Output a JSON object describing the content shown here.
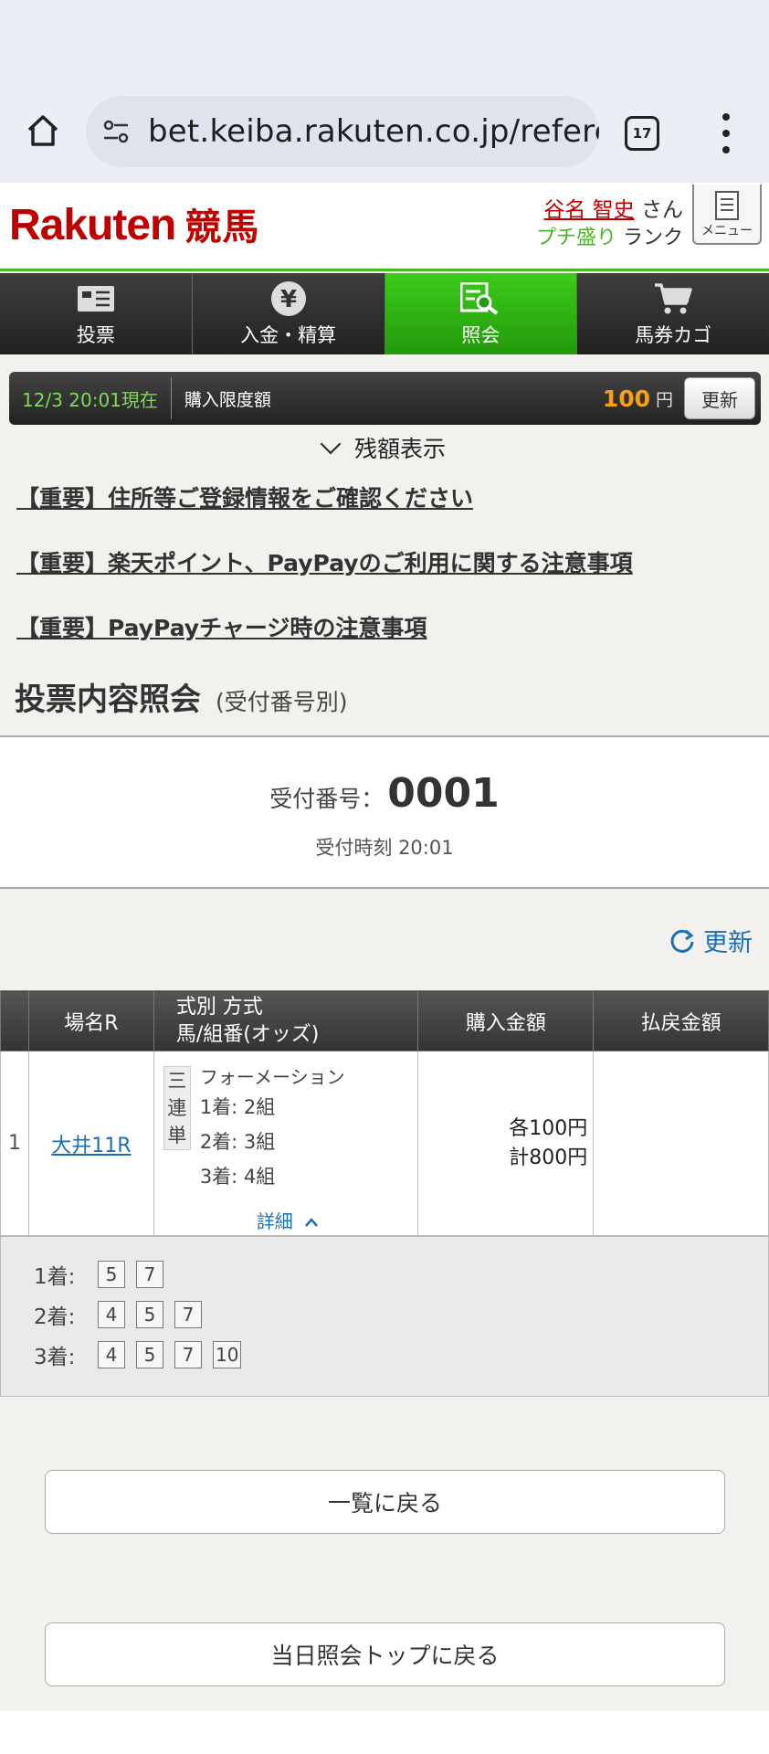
{
  "browser": {
    "url": "bet.keiba.rakuten.co.jp/referen",
    "tab_count": "17"
  },
  "header": {
    "logo_brand": "Rakuten",
    "logo_suffix": "競馬",
    "user_name": "谷名 智史",
    "user_honorific": "さん",
    "rank_name": "プチ盛り",
    "rank_label": "ランク",
    "menu_label": "メニュー"
  },
  "nav": [
    {
      "label": "投票",
      "icon": "ballot-icon",
      "active": false
    },
    {
      "label": "入金・精算",
      "icon": "yen-icon",
      "active": false
    },
    {
      "label": "照会",
      "icon": "inquiry-icon",
      "active": true
    },
    {
      "label": "馬券カゴ",
      "icon": "cart-icon",
      "active": false
    }
  ],
  "info_bar": {
    "datetime": "12/3 20:01現在",
    "limit_label": "購入限度額",
    "limit_amount": "100",
    "limit_unit": "円",
    "refresh_label": "更新"
  },
  "balance_toggle": "残額表示",
  "notices": [
    "【重要】住所等ご登録情報をご確認ください",
    "【重要】楽天ポイント、PayPayのご利用に関する注意事項",
    "【重要】PayPayチャージ時の注意事項"
  ],
  "section": {
    "title": "投票内容照会",
    "subtitle": "(受付番号別)"
  },
  "receipt": {
    "number_label": "受付番号：",
    "number": "0001",
    "time_label": "受付時刻 20:01"
  },
  "refresh_link": "更新",
  "table": {
    "headers": {
      "venue": "場名R",
      "type_line1": "式別 方式",
      "type_line2": "馬/組番(オッズ)",
      "purchase": "購入金額",
      "payout": "払戻金額"
    },
    "row": {
      "index": "1",
      "venue": "大井11R",
      "bet_type": "三連単",
      "method": "フォーメーション",
      "lines": [
        "1着: 2組",
        "2着: 3組",
        "3着: 4組"
      ],
      "detail_label": "詳細",
      "amount_each": "各100円",
      "amount_total": "計800円",
      "payout": ""
    }
  },
  "detail": [
    {
      "label": "1着:",
      "horses": [
        "5",
        "7"
      ]
    },
    {
      "label": "2着:",
      "horses": [
        "4",
        "5",
        "7"
      ]
    },
    {
      "label": "3着:",
      "horses": [
        "4",
        "5",
        "7",
        "10"
      ]
    }
  ],
  "buttons": {
    "back_to_list": "一覧に戻る",
    "back_to_top": "当日照会トップに戻る"
  },
  "colors": {
    "brand_red": "#bf0000",
    "accent_green": "#47b91f",
    "link_blue": "#1a6fb5",
    "amount_orange": "#f8a212"
  }
}
